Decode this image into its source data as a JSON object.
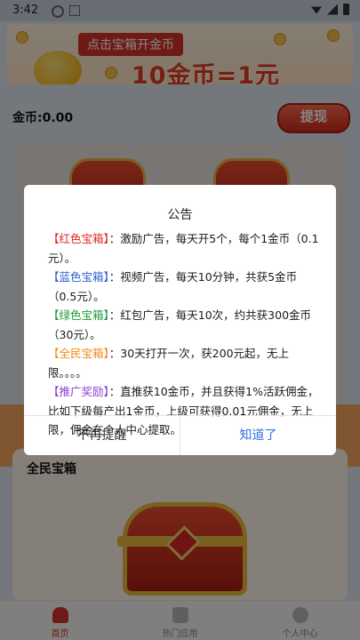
{
  "status_bar": {
    "time": "3:42"
  },
  "banner": {
    "tag": "点击宝箱开金币",
    "headline": "10金币=1元"
  },
  "gold": {
    "label": "金币:0.00",
    "withdraw_label": "提现"
  },
  "section": {
    "title": "全民宝箱"
  },
  "tabs": [
    {
      "label": "首页",
      "icon": "home-icon"
    },
    {
      "label": "热门应用",
      "icon": "apps-icon"
    },
    {
      "label": "个人中心",
      "icon": "user-icon"
    }
  ],
  "dialog": {
    "title": "公告",
    "items": [
      {
        "tag": "【红色宝箱】",
        "color": "#e0281f",
        "text": "：激励广告，每天开5个，每个1金币（0.1元）。"
      },
      {
        "tag": "【蓝色宝箱】",
        "color": "#2d5fd0",
        "text": "：视频广告，每天10分钟，共获5金币（0.5元）。"
      },
      {
        "tag": "【绿色宝箱】",
        "color": "#1e9a3a",
        "text": "：红包广告，每天10次，约共获300金币（30元）。"
      },
      {
        "tag": "【全民宝箱】",
        "color": "#f08a18",
        "text": "：30天打开一次，获200元起，无上限。。。。"
      },
      {
        "tag": "【推广奖励】",
        "color": "#8a3fd0",
        "text": "：直推获10金币，并且获得1%活跃佣金，比如下级每产出1金币，上级可获得0.01元佣金，无上限，佣金在个人中心提取。"
      }
    ],
    "cancel_label": "不再提醒",
    "confirm_label": "知道了"
  }
}
